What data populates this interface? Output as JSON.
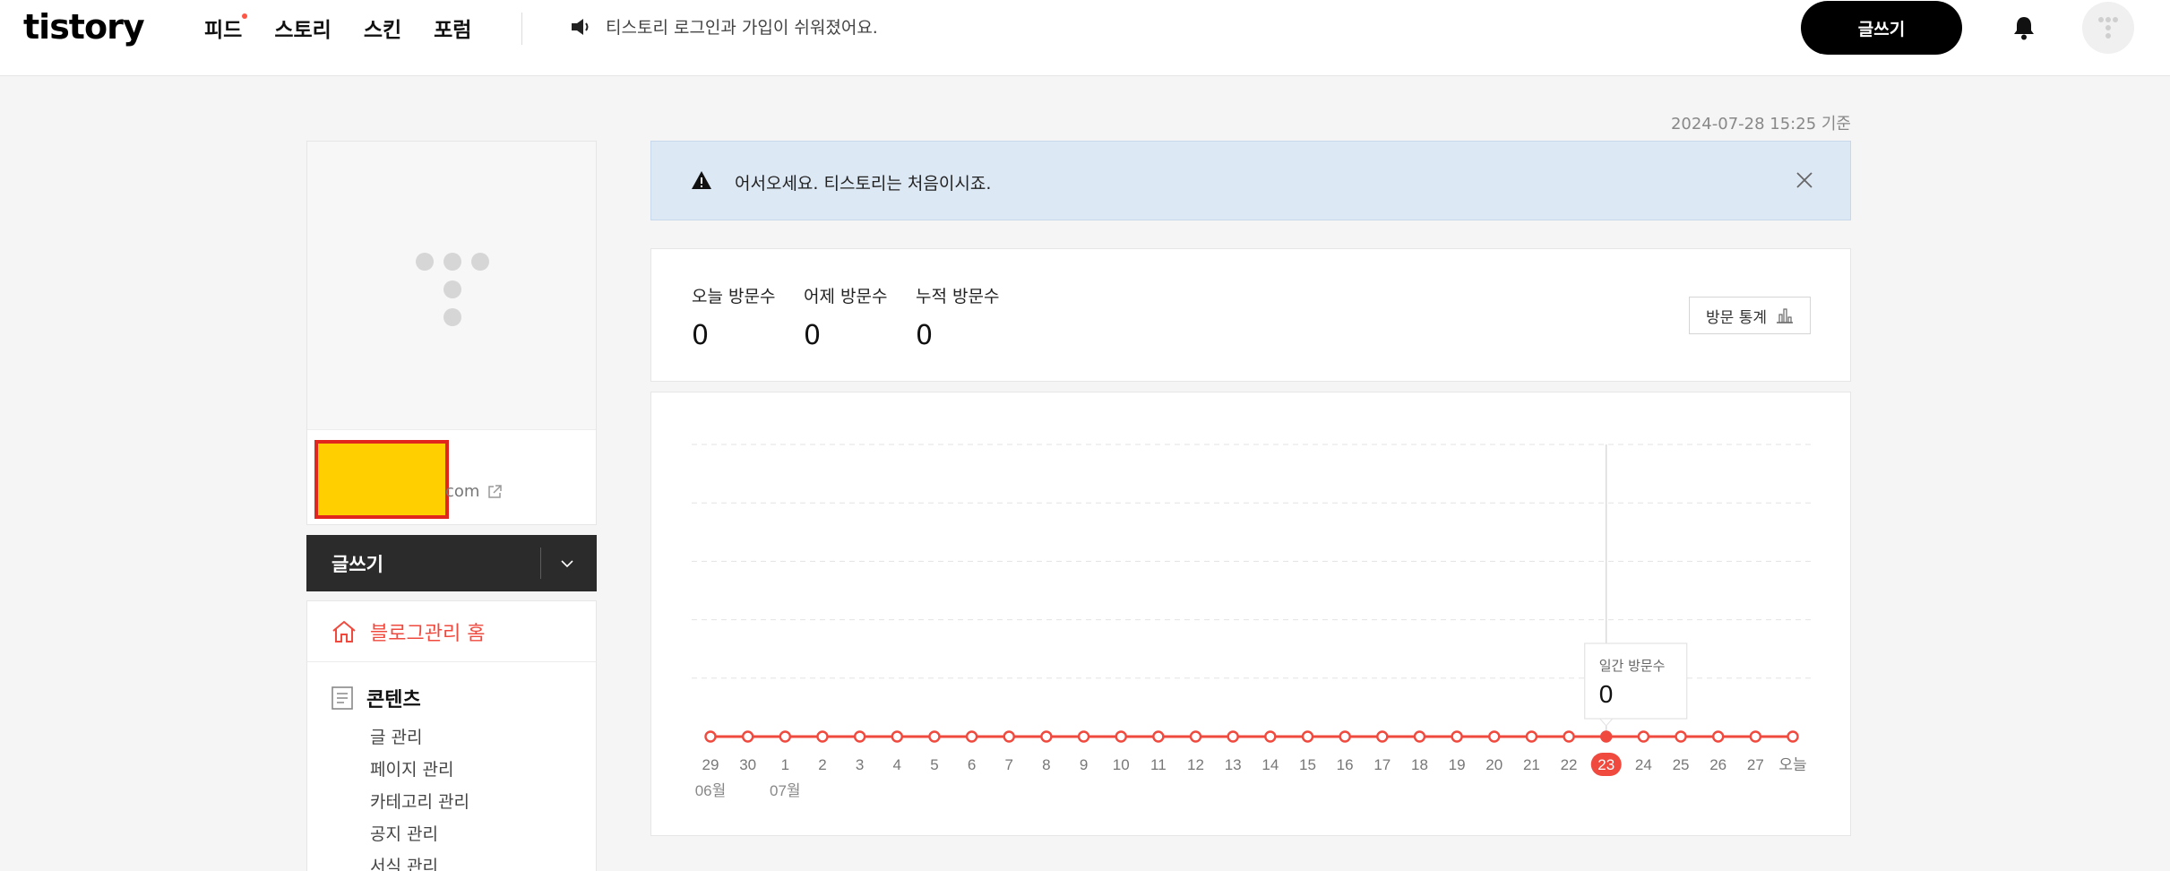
{
  "header": {
    "logo": "tistory",
    "nav": [
      "피드",
      "스토리",
      "스킨",
      "포럼"
    ],
    "notice": "티스토리 로그인과 가입이 쉬워졌어요.",
    "write_button": "글쓰기"
  },
  "timestamp": "2024-07-28 15:25 기준",
  "sidebar": {
    "blog_url_suffix": "com",
    "write_label": "글쓰기",
    "home_label": "블로그관리 홈",
    "content_section": "콘텐츠",
    "content_items": [
      "글 관리",
      "페이지 관리",
      "카테고리 관리",
      "공지 관리",
      "서식 관리"
    ]
  },
  "alert": {
    "message": "어서오세요. 티스토리는 처음이시죠."
  },
  "stats": {
    "today_label": "오늘 방문수",
    "today_value": "0",
    "yesterday_label": "어제 방문수",
    "yesterday_value": "0",
    "total_label": "누적 방문수",
    "total_value": "0",
    "stats_button": "방문 통계"
  },
  "chart_data": {
    "type": "line",
    "x": [
      "29",
      "30",
      "1",
      "2",
      "3",
      "4",
      "5",
      "6",
      "7",
      "8",
      "9",
      "10",
      "11",
      "12",
      "13",
      "14",
      "15",
      "16",
      "17",
      "18",
      "19",
      "20",
      "21",
      "22",
      "23",
      "24",
      "25",
      "26",
      "27",
      "오늘"
    ],
    "month_labels": [
      {
        "at": "29",
        "label": "06월"
      },
      {
        "at": "1",
        "label": "07월"
      }
    ],
    "series": [
      {
        "values": [
          0,
          0,
          0,
          0,
          0,
          0,
          0,
          0,
          0,
          0,
          0,
          0,
          0,
          0,
          0,
          0,
          0,
          0,
          0,
          0,
          0,
          0,
          0,
          0,
          0,
          0,
          0,
          0,
          0,
          0
        ]
      }
    ],
    "highlight": "23",
    "tooltip": {
      "label": "일간 방문수",
      "value": "0"
    },
    "grid": true,
    "color": "#f0493e"
  }
}
